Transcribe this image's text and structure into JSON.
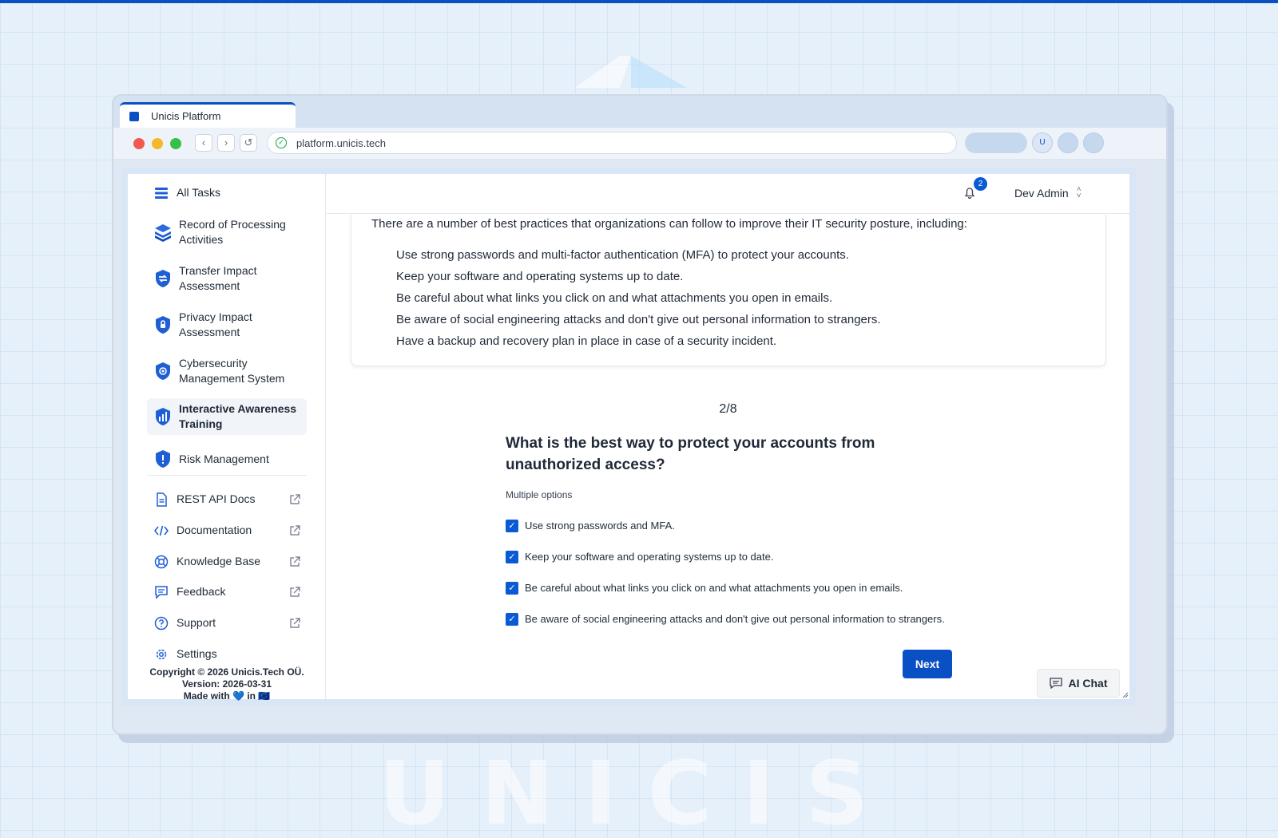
{
  "browser": {
    "tab_title": "Unicis Platform",
    "url": "platform.unicis.tech",
    "avatar_initial": "U"
  },
  "background": {
    "watermark": "UNICIS"
  },
  "sidebar": {
    "items": [
      {
        "label": "All Tasks",
        "icon": "list-icon"
      },
      {
        "label": "Record of Processing Activities",
        "icon": "stack-icon"
      },
      {
        "label": "Transfer Impact Assessment",
        "icon": "transfer-shield-icon"
      },
      {
        "label": "Privacy Impact Assessment",
        "icon": "privacy-shield-icon"
      },
      {
        "label": "Cybersecurity Management System",
        "icon": "cyber-shield-icon"
      },
      {
        "label": "Interactive Awareness Training",
        "icon": "training-icon",
        "active": true
      },
      {
        "label": "Risk Management",
        "icon": "risk-shield-icon"
      }
    ],
    "links": [
      {
        "label": "REST API Docs",
        "icon": "document-icon"
      },
      {
        "label": "Documentation",
        "icon": "code-icon"
      },
      {
        "label": "Knowledge Base",
        "icon": "lifebuoy-icon"
      },
      {
        "label": "Feedback",
        "icon": "chat-bubble-icon"
      },
      {
        "label": "Support",
        "icon": "help-circle-icon"
      }
    ],
    "settings_label": "Settings",
    "footer": {
      "copyright": "Copyright © 2026 Unicis.Tech OÜ.",
      "version": "Version: 2026-03-31",
      "made_with": "Made with 💙 in 🇪🇺"
    }
  },
  "header": {
    "notification_count": "2",
    "user_name": "Dev Admin"
  },
  "content": {
    "intro": "There are a number of best practices that organizations can follow to improve their IT security posture, including:",
    "practices": [
      "Use strong passwords and multi-factor authentication (MFA) to protect your accounts.",
      "Keep your software and operating systems up to date.",
      "Be careful about what links you click on and what attachments you open in emails.",
      "Be aware of social engineering attacks and don't give out personal information to strangers.",
      "Have a backup and recovery plan in place in case of a security incident."
    ],
    "counter": "2/8",
    "question": "What is the best way to protect your accounts from unauthorized access?",
    "hint": "Multiple options",
    "options": [
      {
        "label": "Use strong passwords and MFA.",
        "checked": true
      },
      {
        "label": "Keep your software and operating systems up to date.",
        "checked": true
      },
      {
        "label": "Be careful about what links you click on and what attachments you open in emails.",
        "checked": true
      },
      {
        "label": "Be aware of social engineering attacks and don't give out personal information to strangers.",
        "checked": true
      }
    ],
    "next_label": "Next",
    "ai_chat_label": "AI Chat"
  },
  "colors": {
    "accent": "#0a4fc4",
    "checkbox": "#0a5ad4",
    "background": "#e6f0fa"
  }
}
